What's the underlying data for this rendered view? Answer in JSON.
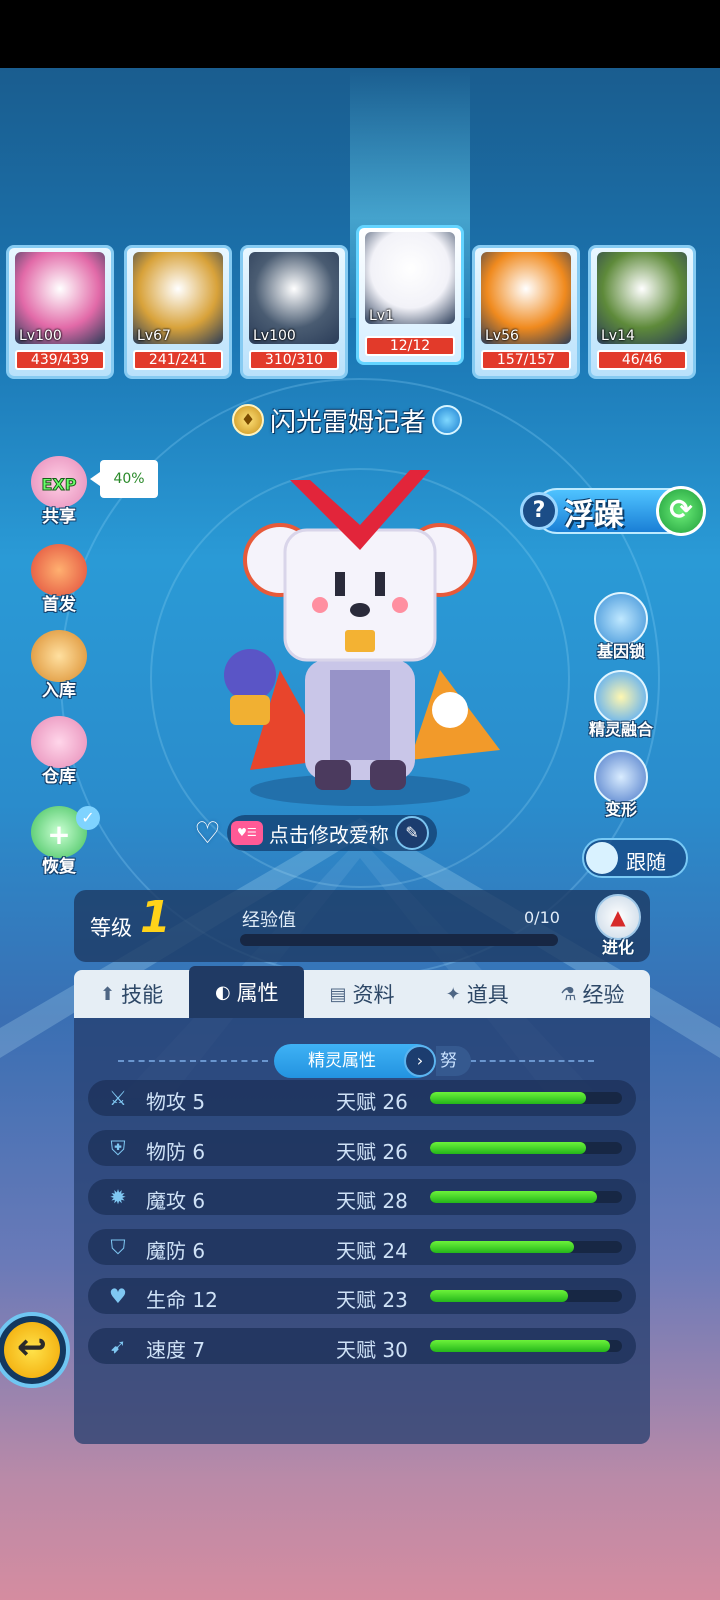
{
  "pets": [
    {
      "level": "Lv100",
      "hp": "439/439",
      "theme": "#e26aa8",
      "face": "pink-fairy"
    },
    {
      "level": "Lv67",
      "hp": "241/241",
      "theme": "#d8a23a",
      "face": "golden-wolf"
    },
    {
      "level": "Lv100",
      "hp": "310/310",
      "theme": "#4a5c72",
      "face": "mecha-beast"
    },
    {
      "level": "Lv1",
      "hp": "12/12",
      "theme": "#f2f2f8",
      "face": "tv-bear",
      "selected": true
    },
    {
      "level": "Lv56",
      "hp": "157/157",
      "theme": "#f08a1e",
      "face": "pumpkin"
    },
    {
      "level": "Lv14",
      "hp": "46/46",
      "theme": "#5e8a3a",
      "face": "forest-dragon"
    }
  ],
  "pet_name": "闪光雷姆记者",
  "left_menu": {
    "share": "共享",
    "share_tooltip": "40%",
    "lead": "首发",
    "store_in": "入库",
    "warehouse": "仓库",
    "restore": "恢复"
  },
  "temperament": "浮躁",
  "right_menu": {
    "gene_lock": "基因锁",
    "fusion": "精灵融合",
    "transform": "变形",
    "follow": "跟随"
  },
  "nickname_hint": "点击修改爱称",
  "level": {
    "label": "等级",
    "value": "1",
    "exp_label": "经验值",
    "exp_value": "0/10",
    "exp_fraction": 0,
    "evolve": "进化"
  },
  "tabs": [
    {
      "label": "技能",
      "icon": "⬆",
      "name": "skills"
    },
    {
      "label": "属性",
      "icon": "◐",
      "name": "attributes",
      "active": true
    },
    {
      "label": "资料",
      "icon": "▤",
      "name": "profile"
    },
    {
      "label": "道具",
      "icon": "✦",
      "name": "items"
    },
    {
      "label": "经验",
      "icon": "⚗",
      "name": "experience"
    }
  ],
  "attr_header": {
    "title": "精灵属性",
    "tail": "努"
  },
  "stats": [
    {
      "name": "物攻 5",
      "talent": "天赋 26",
      "fraction": 0.81,
      "icon": "sword-icon",
      "glyph": "⚔"
    },
    {
      "name": "物防 6",
      "talent": "天赋 26",
      "fraction": 0.81,
      "icon": "shield-icon",
      "glyph": "⛨"
    },
    {
      "name": "魔攻 6",
      "talent": "天赋 28",
      "fraction": 0.87,
      "icon": "flame-icon",
      "glyph": "✹"
    },
    {
      "name": "魔防 6",
      "talent": "天赋 24",
      "fraction": 0.75,
      "icon": "magic-shield-icon",
      "glyph": "⛉"
    },
    {
      "name": "生命 12",
      "talent": "天赋 23",
      "fraction": 0.72,
      "icon": "heart-plus-icon",
      "glyph": "♥"
    },
    {
      "name": "速度 7",
      "talent": "天赋 30",
      "fraction": 0.94,
      "icon": "boot-icon",
      "glyph": "➹"
    }
  ]
}
